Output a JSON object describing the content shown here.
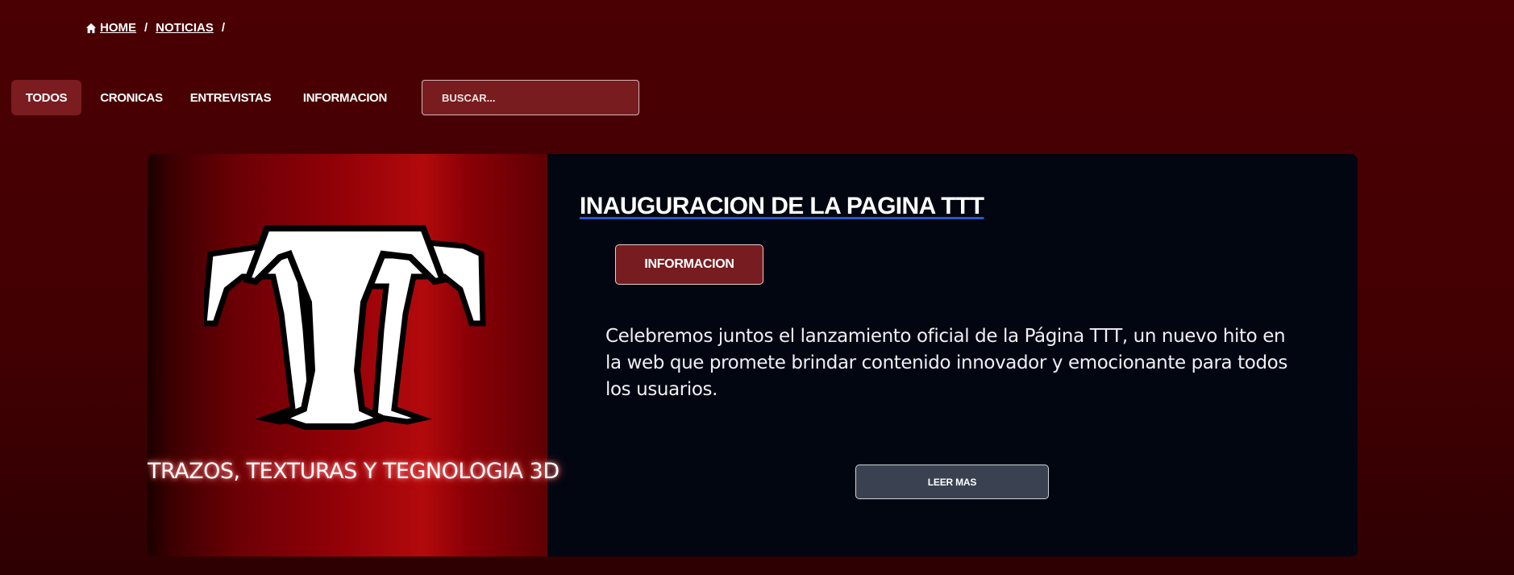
{
  "breadcrumb": {
    "home": "HOME",
    "sep1": "/",
    "news": "NOTICIAS",
    "sep2": "/"
  },
  "tabs": [
    {
      "label": "TODOS",
      "active": true
    },
    {
      "label": "CRONICAS",
      "active": false
    },
    {
      "label": "ENTREVISTAS",
      "active": false
    },
    {
      "label": "INFORMACION",
      "active": false
    }
  ],
  "search": {
    "placeholder": "BUSCAR..."
  },
  "post": {
    "logo_letters": "TT",
    "image_caption": "TRAZOS, TEXTURAS Y TEGNOLOGIA 3D",
    "title": "INAUGURACION DE LA PAGINA TTT",
    "category": "INFORMACION",
    "excerpt": "Celebremos juntos el lanzamiento oficial de la Página TTT, un nuevo hito en la web que promete brindar contenido innovador y emocionante para todos los usuarios.",
    "read_more": "LEER MAS"
  },
  "colors": {
    "background": "#4a0003",
    "accent": "#7a1c20",
    "card": "#020611",
    "read_more": "#3a4252"
  },
  "icons": {
    "home": "home-icon"
  }
}
